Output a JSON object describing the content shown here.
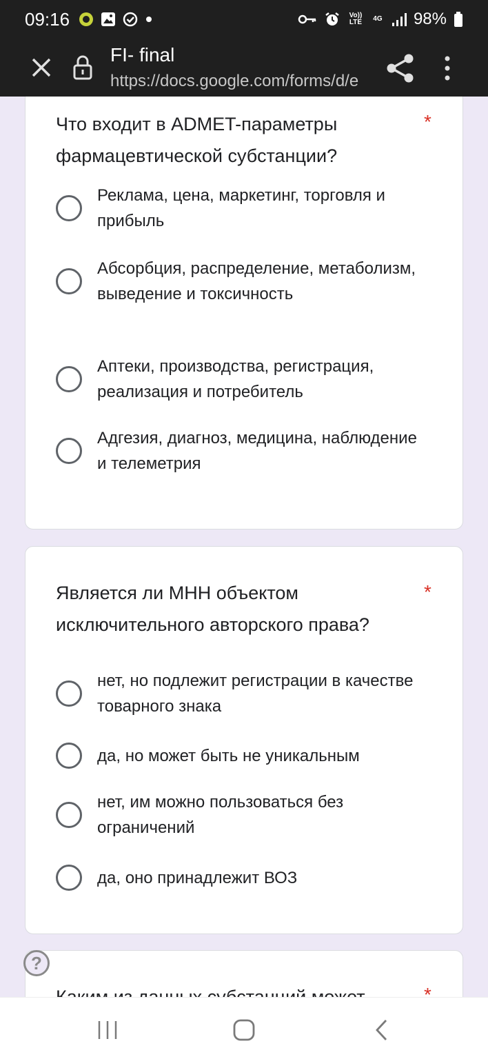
{
  "status_bar": {
    "time": "09:16",
    "left_icons": [
      "whatsapp-icon",
      "gallery-icon",
      "check-circle-icon",
      "dot-icon"
    ],
    "right_icons": [
      "key-icon",
      "alarm-icon",
      "volte-icon",
      "network-4g-icon",
      "signal-icon",
      "battery-icon"
    ],
    "volte_label": "Vo)) LTE",
    "network_label": "4G",
    "battery": "98%"
  },
  "app_bar": {
    "title": "FI- final",
    "url": "https://docs.google.com/forms/d/e"
  },
  "questions": [
    {
      "text": "Что входит в ADMET-параметры фармацевтической субстанции?",
      "required_mark": "*",
      "options": [
        "Реклама, цена, маркетинг, торговля и прибыль",
        "Абсорбция, распределение, метаболизм, выведение и токсичность",
        "Аптеки, производства, регистрация, реализация и потребитель",
        "Адгезия, диагноз, медицина, наблюдение и телеметрия"
      ]
    },
    {
      "text": "Является ли МНН объектом исключительного авторского права?",
      "required_mark": "*",
      "options": [
        "нет, но подлежит регистрации в качестве товарного знака",
        "да, но может быть не уникальным",
        "нет, им можно пользоваться без ограничений",
        "да, оно принадлежит ВОЗ"
      ]
    },
    {
      "text": "Каким из данных субстанций может",
      "required_mark": "*"
    }
  ],
  "colors": {
    "background": "#ede8f6",
    "app_bar": "#1f1f1f",
    "required": "#d93025",
    "radio_border": "#5f6368"
  }
}
